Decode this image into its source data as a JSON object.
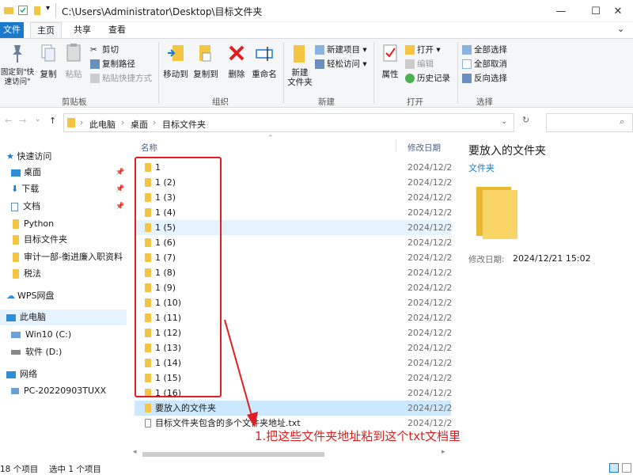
{
  "window": {
    "title": "C:\\Users\\Administrator\\Desktop\\目标文件夹",
    "minimize": "—",
    "maximize": "☐",
    "close": "✕"
  },
  "tabs": {
    "file": "文件",
    "home": "主页",
    "share": "共享",
    "view": "查看"
  },
  "ribbon": {
    "pin_quick_access": "固定到\"快速访问\"",
    "copy": "复制",
    "paste": "粘贴",
    "cut": "剪切",
    "copy_path": "复制路径",
    "paste_shortcut": "粘贴快捷方式",
    "clipboard_group": "剪贴板",
    "move_to": "移动到",
    "copy_to": "复制到",
    "delete": "删除",
    "rename": "重命名",
    "organize_group": "组织",
    "new_item": "新建项目",
    "easy_access": "轻松访问",
    "new_folder": "新建\n文件夹",
    "new_group": "新建",
    "properties": "属性",
    "open": "打开",
    "edit": "编辑",
    "history": "历史记录",
    "open_group": "打开",
    "select_all": "全部选择",
    "select_none": "全部取消",
    "invert_selection": "反向选择",
    "select_group": "选择"
  },
  "address": {
    "crumbs": [
      "此电脑",
      "桌面",
      "目标文件夹"
    ]
  },
  "nav": {
    "items": [
      {
        "label": "快速访问",
        "level": 0,
        "icon": "star-icon"
      },
      {
        "label": "桌面",
        "level": 1,
        "icon": "desktop-icon"
      },
      {
        "label": "下载",
        "level": 1,
        "icon": "download-icon"
      },
      {
        "label": "文档",
        "level": 1,
        "icon": "document-icon"
      },
      {
        "label": "Python",
        "level": 1,
        "icon": "folder-icon"
      },
      {
        "label": "目标文件夹",
        "level": 1,
        "icon": "folder-icon"
      },
      {
        "label": "审计一部-衡进廉入职资料",
        "level": 1,
        "icon": "folder-icon"
      },
      {
        "label": "税法",
        "level": 1,
        "icon": "folder-icon"
      },
      {
        "label": "WPS网盘",
        "level": 0,
        "icon": "cloud-icon"
      },
      {
        "label": "此电脑",
        "level": 0,
        "icon": "computer-icon"
      },
      {
        "label": "Win10 (C:)",
        "level": 1,
        "icon": "drive-icon"
      },
      {
        "label": "软件 (D:)",
        "level": 1,
        "icon": "drive-icon"
      },
      {
        "label": "网络",
        "level": 0,
        "icon": "network-icon"
      },
      {
        "label": "PC-20220903TUXX",
        "level": 1,
        "icon": "computer-icon"
      }
    ]
  },
  "list": {
    "col_name": "名称",
    "col_date": "修改日期",
    "rows": [
      {
        "name": "1",
        "date": "2024/12/2"
      },
      {
        "name": "1 (2)",
        "date": "2024/12/2"
      },
      {
        "name": "1 (3)",
        "date": "2024/12/2"
      },
      {
        "name": "1 (4)",
        "date": "2024/12/2"
      },
      {
        "name": "1 (5)",
        "date": "2024/12/2"
      },
      {
        "name": "1 (6)",
        "date": "2024/12/2"
      },
      {
        "name": "1 (7)",
        "date": "2024/12/2"
      },
      {
        "name": "1 (8)",
        "date": "2024/12/2"
      },
      {
        "name": "1 (9)",
        "date": "2024/12/2"
      },
      {
        "name": "1 (10)",
        "date": "2024/12/2"
      },
      {
        "name": "1 (11)",
        "date": "2024/12/2"
      },
      {
        "name": "1 (12)",
        "date": "2024/12/2"
      },
      {
        "name": "1 (13)",
        "date": "2024/12/2"
      },
      {
        "name": "1 (14)",
        "date": "2024/12/2"
      },
      {
        "name": "1 (15)",
        "date": "2024/12/2"
      },
      {
        "name": "1 (16)",
        "date": "2024/12/2"
      },
      {
        "name": "要放入的文件夹",
        "date": "2024/12/2"
      },
      {
        "name": "目标文件夹包含的多个文件夹地址.txt",
        "date": "2024/12/2"
      }
    ]
  },
  "details": {
    "title": "要放入的文件夹",
    "type": "文件夹",
    "modified_label": "修改日期:",
    "modified_value": "2024/12/21 15:02"
  },
  "annotation": "1.把这些文件夹地址粘到这个txt文档里",
  "status": {
    "count": "18 个项目",
    "selected": "选中 1 个项目"
  },
  "colors": {
    "accent": "#1979ca",
    "annotation": "#e02020",
    "folder": "#f4c542"
  }
}
